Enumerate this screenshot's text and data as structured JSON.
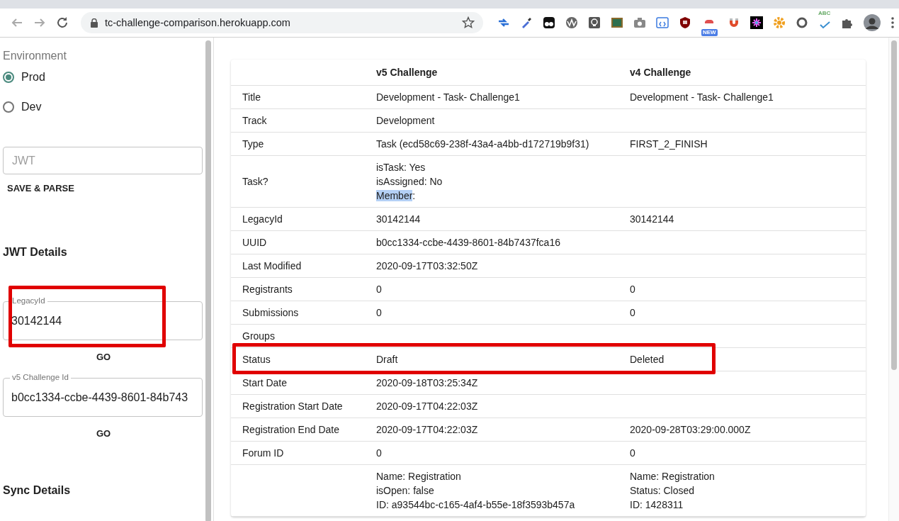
{
  "browser": {
    "url": "tc-challenge-comparison.herokuapp.com",
    "extensions": [
      {
        "kind": "arrows"
      },
      {
        "kind": "dropper"
      },
      {
        "kind": "eyes"
      },
      {
        "kind": "wave"
      },
      {
        "kind": "bulb"
      },
      {
        "kind": "board"
      },
      {
        "kind": "camera"
      },
      {
        "kind": "code"
      },
      {
        "kind": "shield"
      },
      {
        "kind": "alert",
        "badge": "NEW"
      },
      {
        "kind": "magnet"
      },
      {
        "kind": "burst"
      },
      {
        "kind": "gear"
      },
      {
        "kind": "ring"
      },
      {
        "kind": "spell",
        "label": "ABC"
      },
      {
        "kind": "puzzle"
      }
    ]
  },
  "sidebar": {
    "environment": {
      "label": "Environment",
      "options": [
        {
          "label": "Prod",
          "selected": true
        },
        {
          "label": "Dev",
          "selected": false
        }
      ]
    },
    "jwt_field": {
      "placeholder": "JWT"
    },
    "save_button": "SAVE & PARSE",
    "jwt_details_heading": "JWT Details",
    "legacy_field": {
      "label": "LegacyId",
      "value": "30142144",
      "highlighted": true
    },
    "legacy_go": "GO",
    "v5_field": {
      "label": "v5 Challenge Id",
      "value": "b0cc1334-ccbe-4439-8601-84b743",
      "highlighted": false
    },
    "v5_go": "GO",
    "sync_heading": "Sync Details"
  },
  "table": {
    "columns": [
      "v5 Challenge",
      "v4 Challenge"
    ],
    "rows": [
      {
        "label": "Title",
        "v5": [
          "Development - Task- Challenge1"
        ],
        "v4": [
          "Development - Task- Challenge1"
        ],
        "highlighted": false
      },
      {
        "label": "Track",
        "v5": [
          "Development"
        ],
        "highlighted": false
      },
      {
        "label": "Type",
        "v5": [
          "Task (ecd58c69-238f-43a4-a4bb-d172719b9f31)"
        ],
        "v4": [
          "FIRST_2_FINISH"
        ],
        "highlighted": false
      },
      {
        "label": "Task?",
        "v5": [
          "isTask: Yes",
          "isAssigned: No",
          {
            "parts": [
              {
                "text": "Member",
                "selected": true
              },
              {
                "text": ":",
                "selected": false
              }
            ]
          }
        ],
        "highlighted": false
      },
      {
        "label": "LegacyId",
        "v5": [
          "30142144"
        ],
        "v4": [
          "30142144"
        ],
        "highlighted": false
      },
      {
        "label": "UUID",
        "v5": [
          "b0cc1334-ccbe-4439-8601-84b7437fca16"
        ],
        "highlighted": false
      },
      {
        "label": "Last Modified",
        "v5": [
          "2020-09-17T03:32:50Z"
        ],
        "highlighted": false
      },
      {
        "label": "Registrants",
        "v5": [
          "0"
        ],
        "v4": [
          "0"
        ],
        "highlighted": false
      },
      {
        "label": "Submissions",
        "v5": [
          "0"
        ],
        "v4": [
          "0"
        ],
        "highlighted": false
      },
      {
        "label": "Groups",
        "highlighted": false
      },
      {
        "label": "Status",
        "v5": [
          "Draft"
        ],
        "v4": [
          "Deleted"
        ],
        "highlighted": true
      },
      {
        "label": "Start Date",
        "v5": [
          "2020-09-18T03:25:34Z"
        ],
        "highlighted": false
      },
      {
        "label": "Registration Start Date",
        "v5": [
          "2020-09-17T04:22:03Z"
        ],
        "highlighted": false
      },
      {
        "label": "Registration End Date",
        "v5": [
          "2020-09-17T04:22:03Z"
        ],
        "v4": [
          "2020-09-28T03:29:00.000Z"
        ],
        "highlighted": false
      },
      {
        "label": "Forum ID",
        "v5": [
          "0"
        ],
        "v4": [
          "0"
        ],
        "highlighted": false
      },
      {
        "v5": [
          "Name: Registration",
          "isOpen: false",
          "ID: a93544bc-c165-4af4-b55e-18f3593b457a"
        ],
        "v4": [
          "Name: Registration",
          "Status: Closed",
          "ID: 1428311"
        ],
        "highlighted": false
      }
    ]
  }
}
